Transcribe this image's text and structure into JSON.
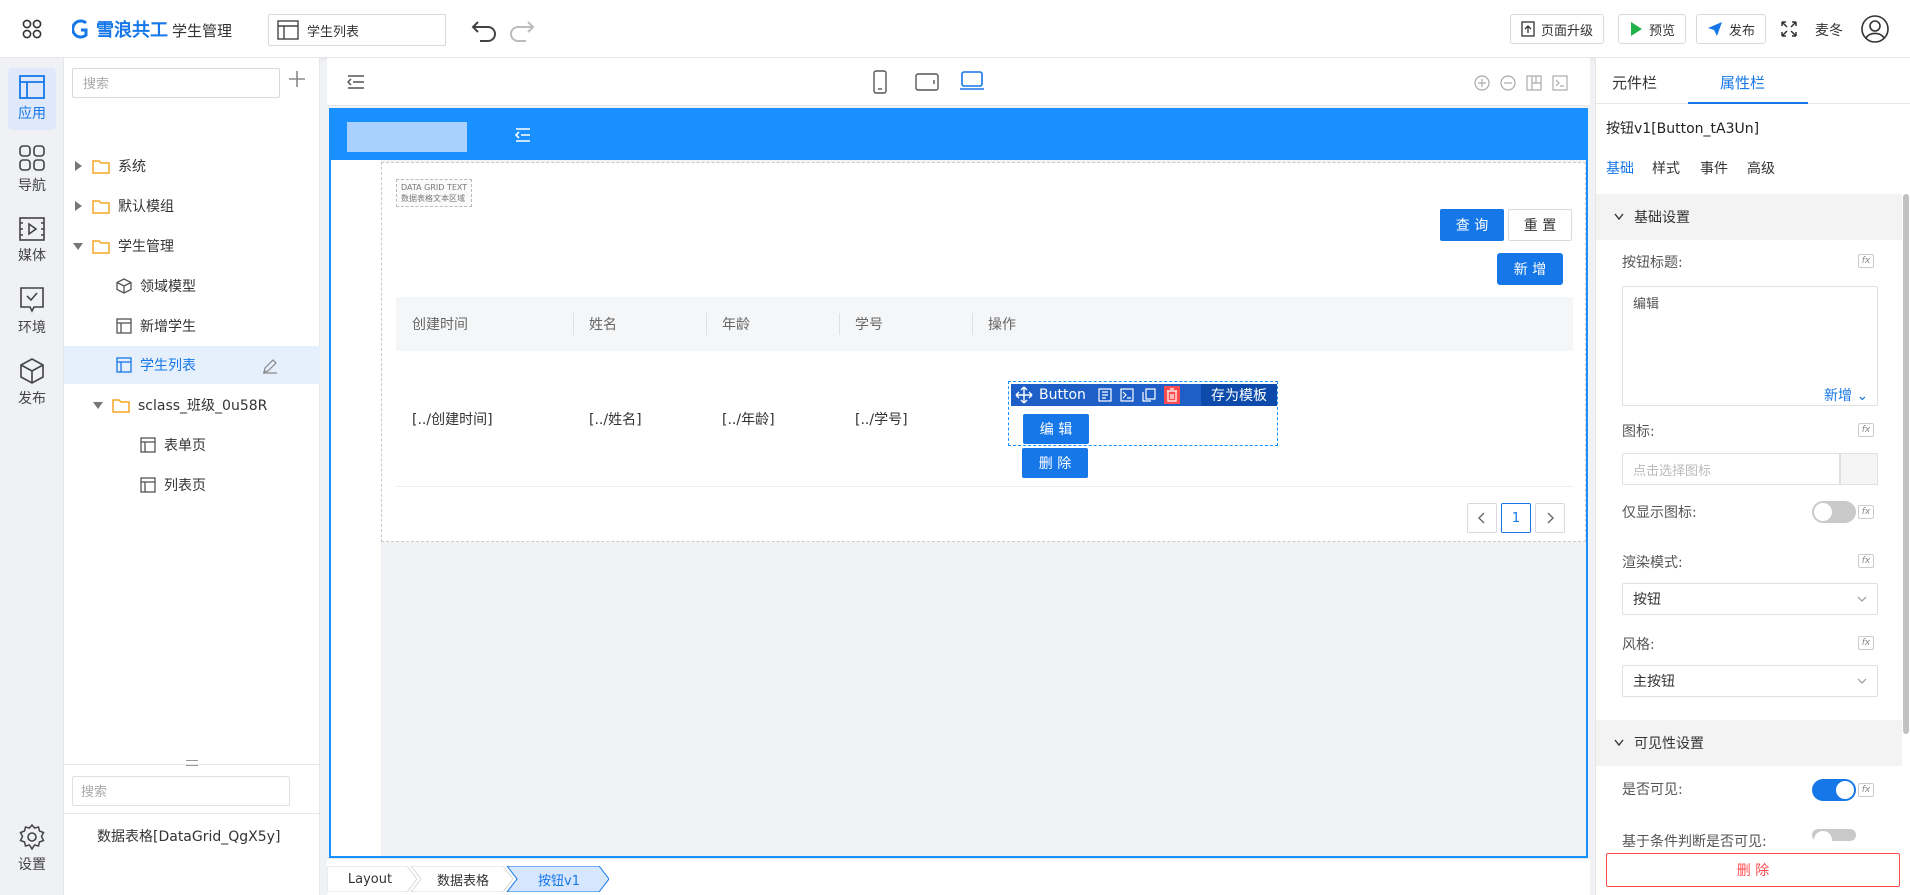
{
  "topbar": {
    "brand": "雪浪共工",
    "app_name": "学生管理",
    "page_select": "学生列表",
    "upgrade": "页面升级",
    "preview": "预览",
    "publish": "发布",
    "user": "麦冬"
  },
  "rail": {
    "items": [
      {
        "label": "应用",
        "icon": "app-icon"
      },
      {
        "label": "导航",
        "icon": "grid-icon"
      },
      {
        "label": "媒体",
        "icon": "media-icon"
      },
      {
        "label": "环境",
        "icon": "env-icon"
      },
      {
        "label": "发布",
        "icon": "cube-icon"
      }
    ],
    "settings": "设置"
  },
  "tree": {
    "search_placeholder": "搜索",
    "nodes": [
      {
        "label": "系统"
      },
      {
        "label": "默认模组"
      },
      {
        "label": "学生管理"
      },
      {
        "label": "领域模型"
      },
      {
        "label": "新增学生"
      },
      {
        "label": "学生列表"
      },
      {
        "label": "sclass_班级_0u58R"
      },
      {
        "label": "表单页"
      },
      {
        "label": "列表页"
      }
    ],
    "bottom_search_placeholder": "搜索",
    "component_path": "数据表格[DataGrid_QgX5y]"
  },
  "canvas": {
    "grid_tag_line1": "DATA GRID TEXT",
    "grid_tag_line2": "数据表格文本区域",
    "query": "查 询",
    "reset": "重 置",
    "add": "新 增",
    "columns": [
      "创建时间",
      "姓名",
      "年龄",
      "学号",
      "操作"
    ],
    "row": [
      "[../创建时间]",
      "[../姓名]",
      "[../年龄]",
      "[../学号]"
    ],
    "button_toolbar_label": "Button",
    "save_template": "存为模板",
    "edit": "编 辑",
    "delete": "删 除",
    "page": "1"
  },
  "breadcrumbs": [
    "Layout",
    "数据表格",
    "按钮v1"
  ],
  "right": {
    "tab_components": "元件栏",
    "tab_properties": "属性栏",
    "component_name": "按钮v1[Button_tA3Un]",
    "subtabs": [
      "基础",
      "样式",
      "事件",
      "高级"
    ],
    "section_basic": "基础设置",
    "label_title": "按钮标题:",
    "title_value": "编辑",
    "title_add": "新增",
    "label_icon": "图标:",
    "icon_placeholder": "点击选择图标",
    "label_icon_only": "仅显示图标:",
    "label_render": "渲染模式:",
    "render_value": "按钮",
    "label_style": "风格:",
    "style_value": "主按钮",
    "section_visibility": "可见性设置",
    "label_visible": "是否可见:",
    "label_cond_visible": "基于条件判断是否可见:",
    "delete": "删 除",
    "fx": "fx"
  },
  "colors": {
    "primary": "#1677e8",
    "header": "#1890ff",
    "danger": "#ff4d4f"
  }
}
